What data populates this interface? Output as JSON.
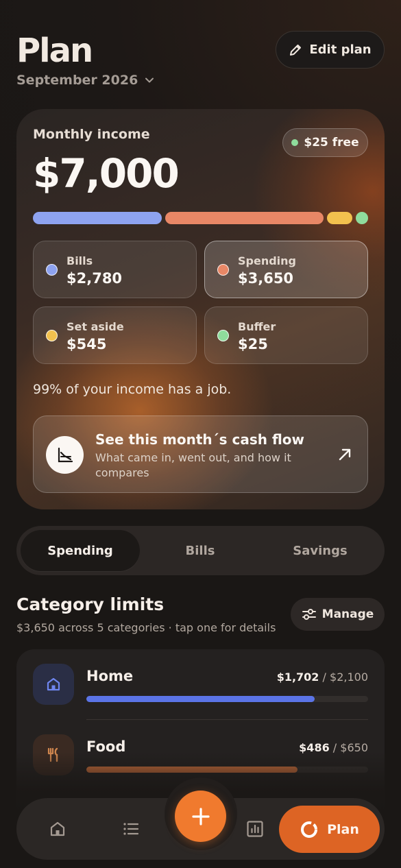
{
  "header": {
    "title": "Plan",
    "month": "September 2026",
    "edit_label": "Edit plan"
  },
  "summary": {
    "income_label": "Monthly income",
    "income_value": "$7,000",
    "free_label": "$25 free",
    "allocation": [
      {
        "name": "Bills",
        "amount": 2780,
        "color": "#8ea3f0"
      },
      {
        "name": "Spending",
        "amount": 3650,
        "color": "#e88766"
      },
      {
        "name": "Set aside",
        "amount": 545,
        "color": "#f2c14e"
      },
      {
        "name": "Buffer",
        "amount": 25,
        "color": "#8fdc9c"
      }
    ],
    "tiles": [
      {
        "label": "Bills",
        "value": "$2,780",
        "color": "#8ea3f0"
      },
      {
        "label": "Spending",
        "value": "$3,650",
        "color": "#e88766"
      },
      {
        "label": "Set aside",
        "value": "$545",
        "color": "#f2c14e"
      },
      {
        "label": "Buffer",
        "value": "$25",
        "color": "#8fdc9c"
      }
    ],
    "job_text": "99% of your income has a job.",
    "cashflow_title": "See this month´s cash flow",
    "cashflow_sub": "What came in, went out, and how it compares"
  },
  "tabs": [
    {
      "label": "Spending",
      "active": true
    },
    {
      "label": "Bills",
      "active": false
    },
    {
      "label": "Savings",
      "active": false
    }
  ],
  "category_limits": {
    "title": "Category limits",
    "subtitle": "$3,650 across 5 categories · tap one for details",
    "manage_label": "Manage",
    "items": [
      {
        "name": "Home",
        "spent": "$1,702",
        "limit": "/ $2,100",
        "progress": 0.81,
        "icon": "home-icon",
        "color": "#5b74e6",
        "icon_bg": "#2a2e45"
      },
      {
        "name": "Food",
        "spent": "$486",
        "limit": "/ $650",
        "progress": 0.75,
        "icon": "fork-knife-icon",
        "color": "#c26a3a",
        "icon_bg": "#3a2a22"
      }
    ]
  },
  "nav": {
    "items": [
      "home-icon",
      "list-icon",
      "add-icon",
      "chart-icon"
    ],
    "plan_label": "Plan"
  },
  "colors": {
    "accent": "#f07a2e",
    "plan_active": "#dd6424"
  }
}
